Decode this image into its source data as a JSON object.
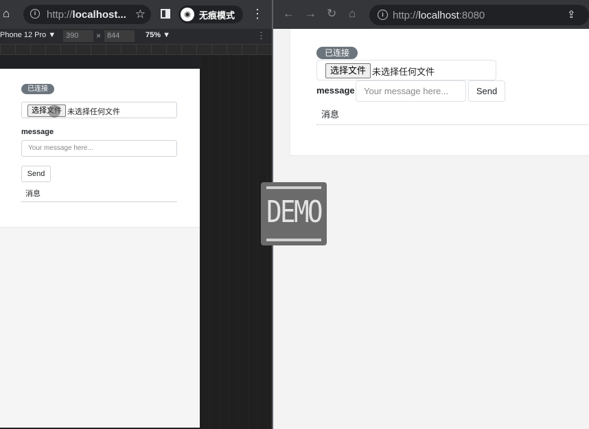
{
  "left_window": {
    "url_prefix": "http://",
    "url_host": "localhost...",
    "incognito_label": "无痕模式",
    "devtools": {
      "device": "Phone 12 Pro ▼",
      "width": "390",
      "times": "×",
      "height": "844",
      "zoom": "75% ▼"
    },
    "page": {
      "status_badge": "已连接",
      "file_button": "选择文件",
      "file_status": "未选择任何文件",
      "message_label": "message",
      "message_placeholder": "Your message here...",
      "send_label": "Send",
      "news_label": "消息"
    }
  },
  "right_window": {
    "url_prefix": "http://",
    "url_host": "localhost",
    "url_port": ":8080",
    "page": {
      "status_badge": "已连接",
      "file_button": "选择文件",
      "file_status": "未选择任何文件",
      "message_label": "message",
      "message_placeholder": "Your message here...",
      "send_label": "Send",
      "news_label": "消息"
    }
  },
  "icons": {
    "home": "⌂",
    "info": "i",
    "star": "☆",
    "kebab": "⋮",
    "back": "←",
    "forward": "→",
    "reload": "↻",
    "share": "⇪",
    "incognito": "◉"
  },
  "watermark": "DEMO",
  "colors": {
    "chrome_dark": "#35363a",
    "badge": "#6c757d",
    "page_bg": "#f3f3f3"
  }
}
